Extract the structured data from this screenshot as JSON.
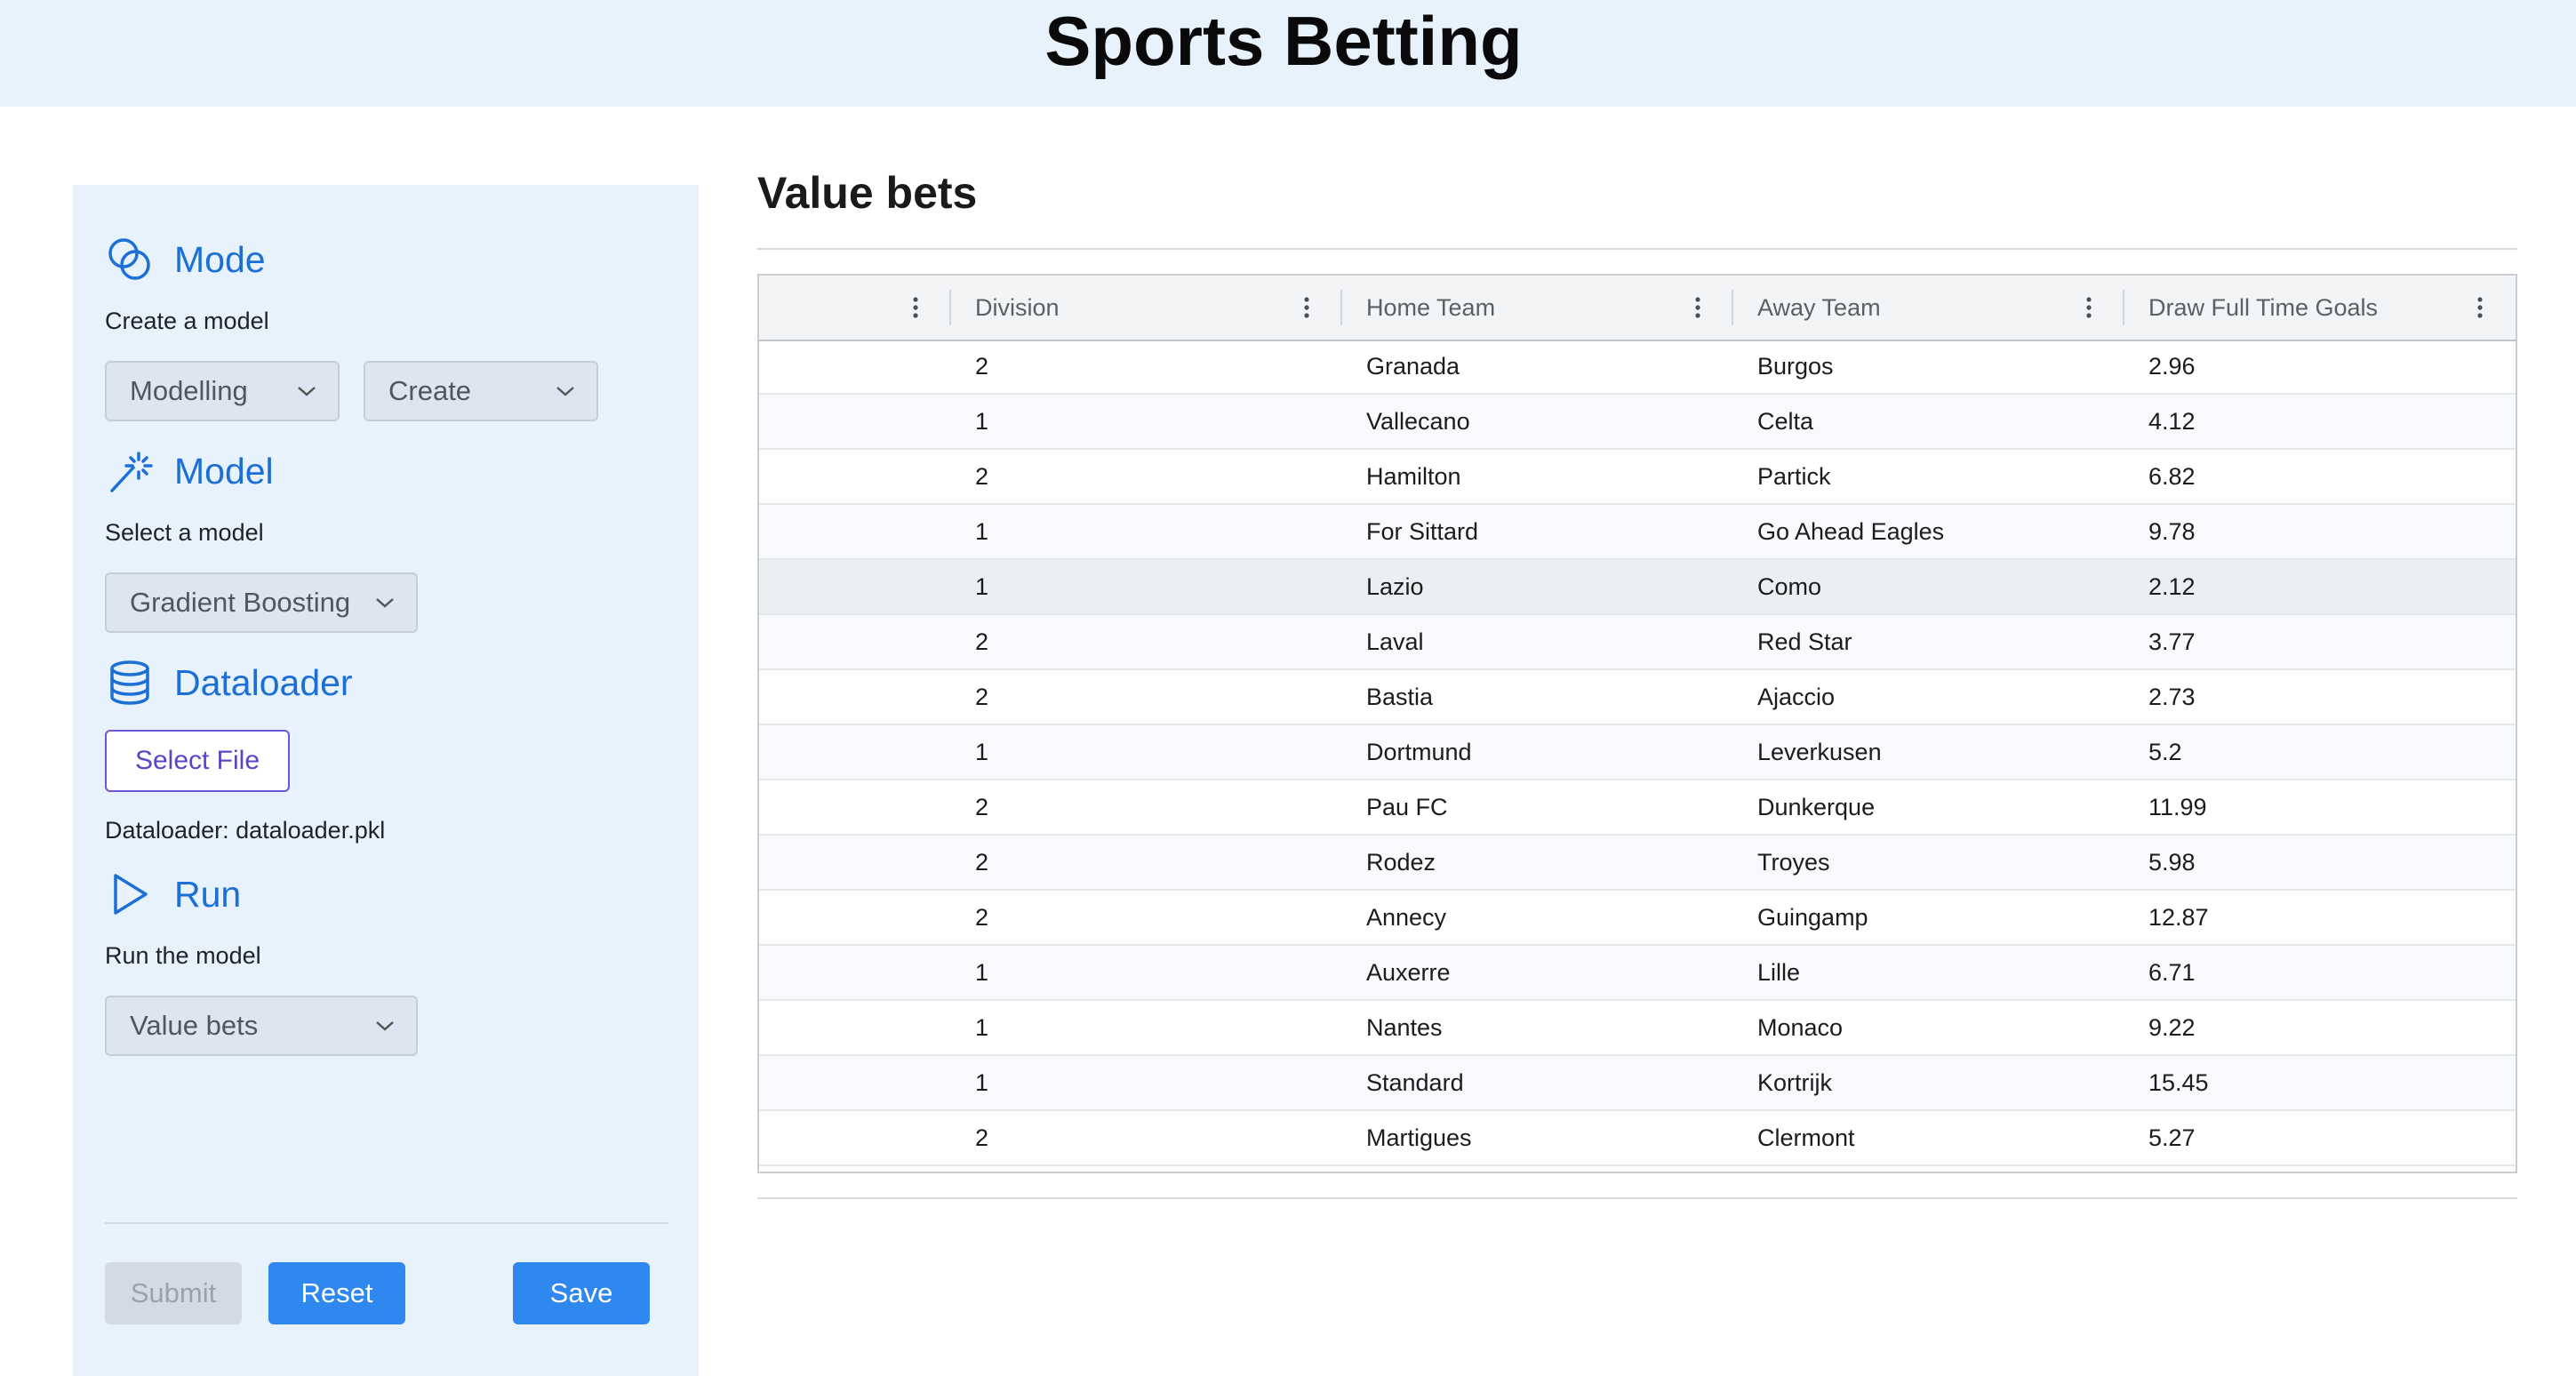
{
  "app": {
    "title": "Sports Betting"
  },
  "sidebar": {
    "mode": {
      "title": "Mode",
      "description": "Create a model",
      "dropdown1": "Modelling",
      "dropdown2": "Create"
    },
    "model": {
      "title": "Model",
      "description": "Select a model",
      "dropdown": "Gradient Boosting"
    },
    "dataloader": {
      "title": "Dataloader",
      "button": "Select File",
      "file_label": "Dataloader: dataloader.pkl"
    },
    "run": {
      "title": "Run",
      "description": "Run the model",
      "dropdown": "Value bets"
    },
    "buttons": {
      "submit": "Submit",
      "reset": "Reset",
      "save": "Save"
    }
  },
  "main": {
    "title": "Value bets",
    "table": {
      "columns": [
        "",
        "Division",
        "Home Team",
        "Away Team",
        "Draw Full Time Goals"
      ],
      "rows": [
        [
          "",
          "2",
          "Granada",
          "Burgos",
          "2.96"
        ],
        [
          "",
          "1",
          "Vallecano",
          "Celta",
          "4.12"
        ],
        [
          "",
          "2",
          "Hamilton",
          "Partick",
          "6.82"
        ],
        [
          "",
          "1",
          "For Sittard",
          "Go Ahead Eagles",
          "9.78"
        ],
        [
          "",
          "1",
          "Lazio",
          "Como",
          "2.12"
        ],
        [
          "",
          "2",
          "Laval",
          "Red Star",
          "3.77"
        ],
        [
          "",
          "2",
          "Bastia",
          "Ajaccio",
          "2.73"
        ],
        [
          "",
          "1",
          "Dortmund",
          "Leverkusen",
          "5.2"
        ],
        [
          "",
          "2",
          "Pau FC",
          "Dunkerque",
          "11.99"
        ],
        [
          "",
          "2",
          "Rodez",
          "Troyes",
          "5.98"
        ],
        [
          "",
          "2",
          "Annecy",
          "Guingamp",
          "12.87"
        ],
        [
          "",
          "1",
          "Auxerre",
          "Lille",
          "6.71"
        ],
        [
          "",
          "1",
          "Nantes",
          "Monaco",
          "9.22"
        ],
        [
          "",
          "1",
          "Standard",
          "Kortrijk",
          "15.45"
        ],
        [
          "",
          "2",
          "Martigues",
          "Clermont",
          "5.27"
        ]
      ],
      "highlighted_row": 4
    }
  },
  "colors": {
    "accent": "#2f87f0",
    "sidebar_bg": "#e7f2fc",
    "section_title": "#1c6fd6",
    "file_button": "#6d55d6"
  },
  "icons": {
    "mode": "overlapping-circles-icon",
    "model": "magic-wand-icon",
    "dataloader": "database-icon",
    "run": "play-icon",
    "dropdown": "chevron-down-icon",
    "column_menu": "kebab-menu-icon"
  }
}
